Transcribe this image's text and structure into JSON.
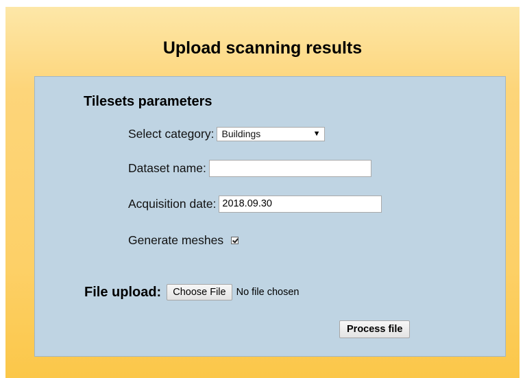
{
  "page": {
    "title": "Upload scanning results"
  },
  "tilesets": {
    "heading": "Tilesets parameters",
    "category_label": "Select category:",
    "category_value": "Buildings",
    "dataset_label": "Dataset name:",
    "dataset_value": "",
    "date_label": "Acquisition date:",
    "date_value": "2018.09.30",
    "meshes_label": "Generate meshes",
    "meshes_checked": true
  },
  "upload": {
    "label": "File upload:",
    "choose_button": "Choose File",
    "status": "No file chosen",
    "process_button": "Process file"
  },
  "colors": {
    "background_top": "#fde7a8",
    "background_bottom": "#fbc749",
    "panel": "#bfd4e3"
  }
}
